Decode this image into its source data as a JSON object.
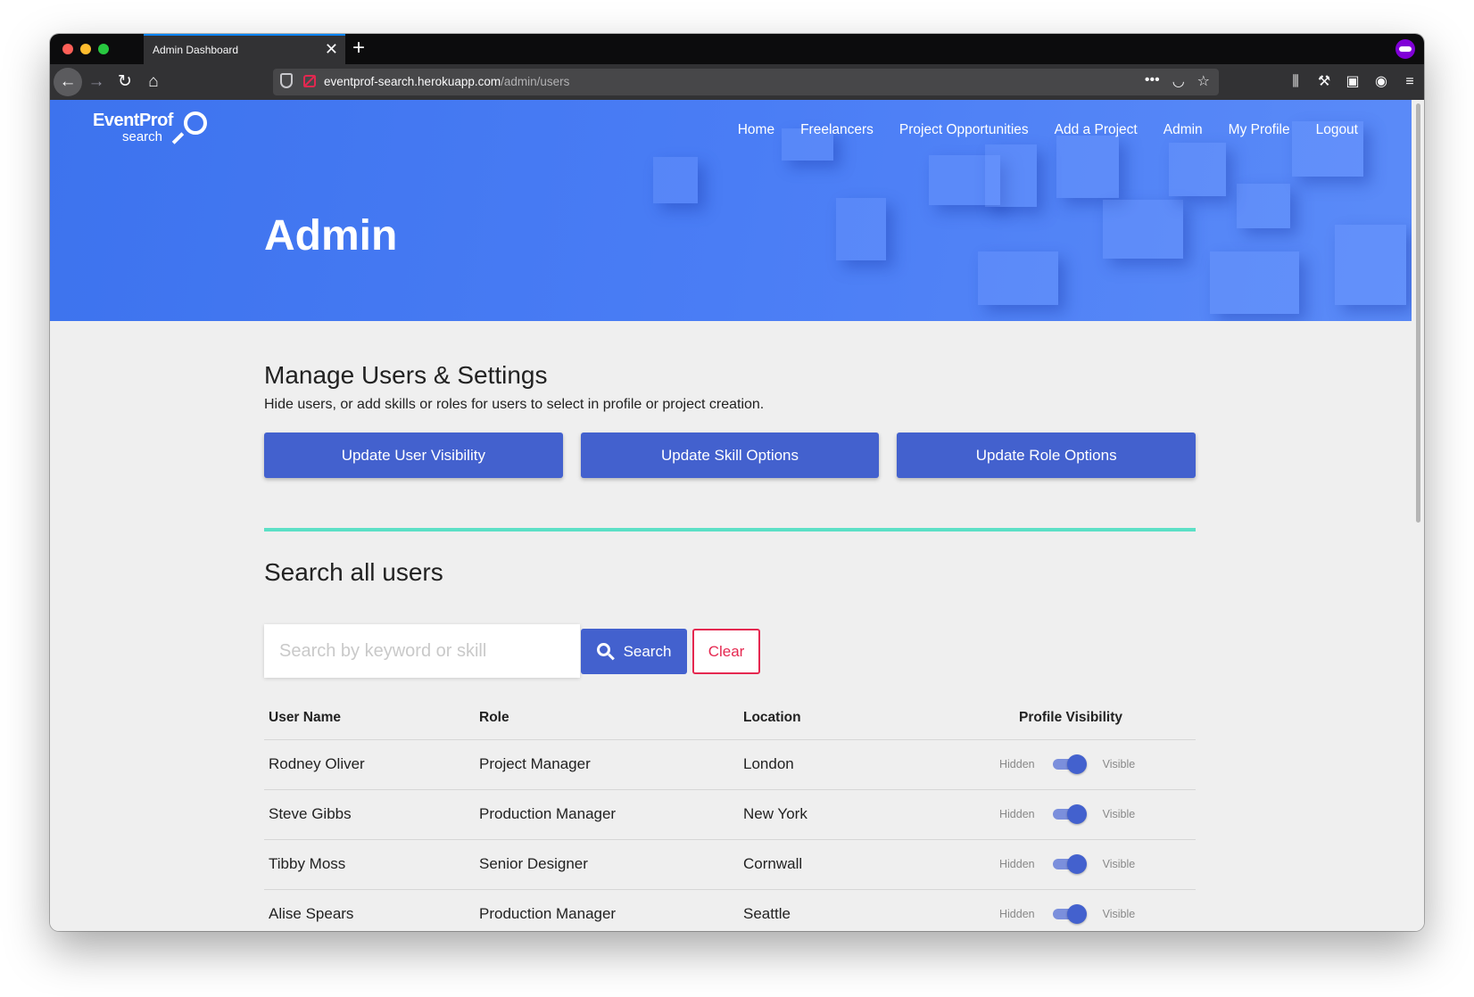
{
  "browser": {
    "tab_title": "Admin Dashboard",
    "tab_close": "✕",
    "new_tab": "+",
    "url_domain": "eventprof-search.herokuapp.com",
    "url_path": "/admin/users",
    "icons": {
      "back": "arrow-left-icon",
      "forward": "arrow-right-icon",
      "reload": "reload-icon",
      "home": "home-icon",
      "more": "more-icon",
      "pocket": "pocket-icon",
      "bookmark": "star-icon",
      "library": "library-icon",
      "tools": "wrench-icon",
      "sidebar": "sidebar-icon",
      "account": "account-icon",
      "menu": "menu-icon"
    }
  },
  "site": {
    "logo_main": "EventProf",
    "logo_sub": "search",
    "nav": [
      "Home",
      "Freelancers",
      "Project Opportunities",
      "Add a Project",
      "Admin",
      "My Profile",
      "Logout"
    ],
    "hero_title": "Admin"
  },
  "manage": {
    "title": "Manage Users & Settings",
    "subtitle": "Hide users, or add skills or roles for users to select in profile or project creation.",
    "buttons": [
      "Update User Visibility",
      "Update Skill Options",
      "Update Role Options"
    ]
  },
  "search": {
    "title": "Search all users",
    "placeholder": "Search by keyword or skill",
    "search_label": "Search",
    "clear_label": "Clear"
  },
  "table": {
    "headers": [
      "User Name",
      "Role",
      "Location",
      "Profile Visibility"
    ],
    "hidden_label": "Hidden",
    "visible_label": "Visible",
    "rows": [
      {
        "name": "Rodney Oliver",
        "role": "Project Manager",
        "location": "London",
        "visible": true
      },
      {
        "name": "Steve Gibbs",
        "role": "Production Manager",
        "location": "New York",
        "visible": true
      },
      {
        "name": "Tibby Moss",
        "role": "Senior Designer",
        "location": "Cornwall",
        "visible": true
      },
      {
        "name": "Alise Spears",
        "role": "Production Manager",
        "location": "Seattle",
        "visible": true
      }
    ]
  },
  "colors": {
    "primary": "#4361ce",
    "hero": "#4a7df5",
    "accent_divider": "#5ce0c6",
    "danger": "#e52850"
  }
}
